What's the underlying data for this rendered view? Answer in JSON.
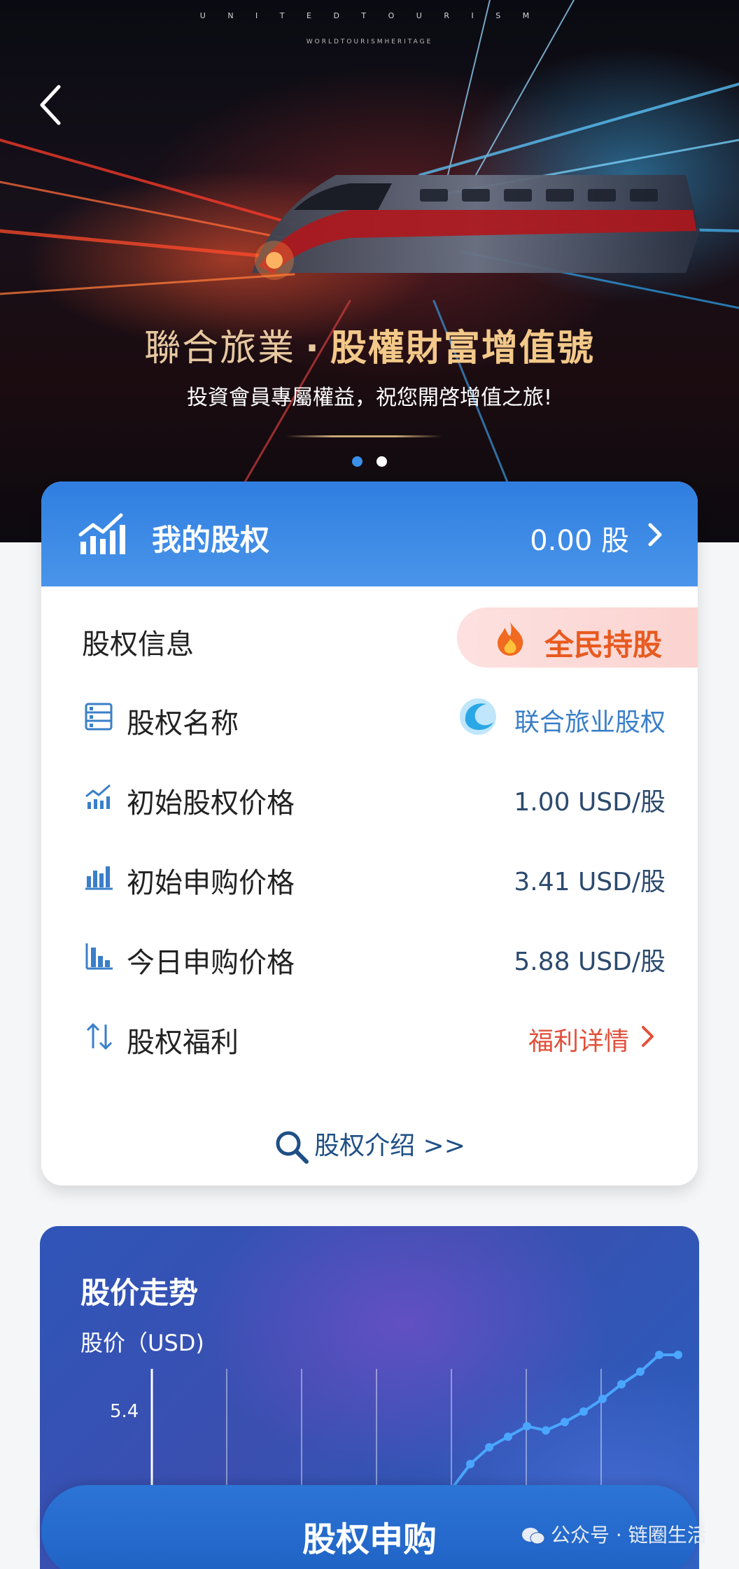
{
  "hero": {
    "brand": "U N I T E D T O U R I S M",
    "brand_sub": "WORLDTOURISMHERITAGE",
    "title_part1": "聯合旅業",
    "title_dot": "·",
    "title_part2": "股權財富增值號",
    "subtitle": "投資會員專屬權益，祝您開啓增值之旅!",
    "carousel_pages": 2,
    "carousel_active": 1
  },
  "equity_card": {
    "header_title": "我的股权",
    "header_value": "0.00 股",
    "section_title": "股权信息",
    "badge": "全民持股",
    "rows": [
      {
        "label": "股权名称",
        "value": "联合旅业股权"
      },
      {
        "label": "初始股权价格",
        "value": "1.00 USD/股"
      },
      {
        "label": "初始申购价格",
        "value": "3.41 USD/股"
      },
      {
        "label": "今日申购价格",
        "value": "5.88 USD/股"
      },
      {
        "label": "股权福利",
        "value": "福利详情"
      }
    ],
    "intro_link": "股权介绍 >>"
  },
  "trend": {
    "title": "股价走势",
    "unit_label": "股价（USD)",
    "tick_label": "5.4"
  },
  "chart_data": {
    "type": "line",
    "ylabel": "股价（USD)",
    "y_tick_visible": [
      5.4
    ],
    "series": [
      {
        "values": [
          5.02,
          5.14,
          5.22,
          5.27,
          5.32,
          5.3,
          5.34,
          5.39,
          5.45,
          5.52,
          5.58,
          5.66,
          5.66
        ]
      }
    ]
  },
  "bottom": {
    "apply_button": "股权申购",
    "watermark": "公众号 · 链圈生活"
  },
  "colors": {
    "accent_blue": "#2f7ee0",
    "badge_orange": "#e85a1f",
    "link_red": "#e2503a",
    "value_navy": "#2c4a6e"
  }
}
